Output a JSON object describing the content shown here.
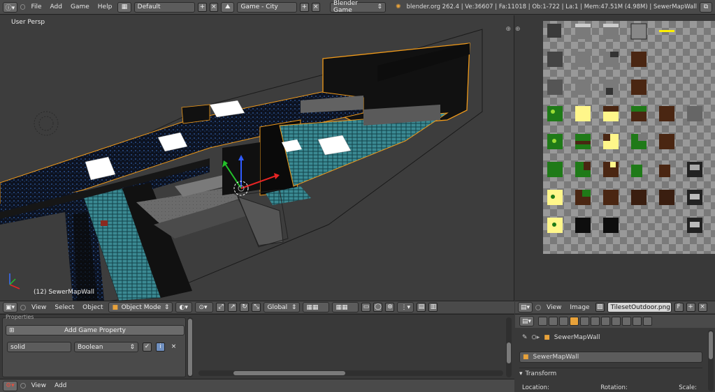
{
  "topbar": {
    "menus": [
      "File",
      "Add",
      "Game",
      "Help"
    ],
    "layout": "Default",
    "scene": "Game - City",
    "engine": "Blender Game",
    "stats": "blender.org 262.4 | Ve:36607 | Fa:11018 | Ob:1-722 | La:1 | Mem:47.51M (4.98M) | SewerMapWall"
  },
  "viewport": {
    "view_label": "User Persp",
    "object_label": "(12) SewerMapWall"
  },
  "view3d_header": {
    "menus": [
      "View",
      "Select",
      "Object"
    ],
    "mode": "Object Mode",
    "orientation": "Global"
  },
  "image_header": {
    "menus": [
      "View",
      "Image"
    ],
    "image_name": "TilesetOutdoor.png",
    "fake_user": "F"
  },
  "logic": {
    "panel_title": "Properties",
    "add_label": "Add Game Property",
    "prop_name": "solid",
    "prop_type": "Boolean"
  },
  "properties": {
    "breadcrumb_object": "SewerMapWall",
    "object_name": "SewerMapWall",
    "transform_label": "Transform",
    "columns": [
      "Location:",
      "Rotation:",
      "Scale:"
    ]
  },
  "bottom_header": {
    "menus": [
      "View",
      "Add"
    ]
  },
  "colors": {
    "accent_orange": "#e8a23a",
    "selection_orange": "#f09a1a",
    "tile_green": "#1f7a18",
    "tile_yellow": "#fff68a",
    "tile_brown": "#4a2612",
    "water_teal": "#3b8a93"
  }
}
